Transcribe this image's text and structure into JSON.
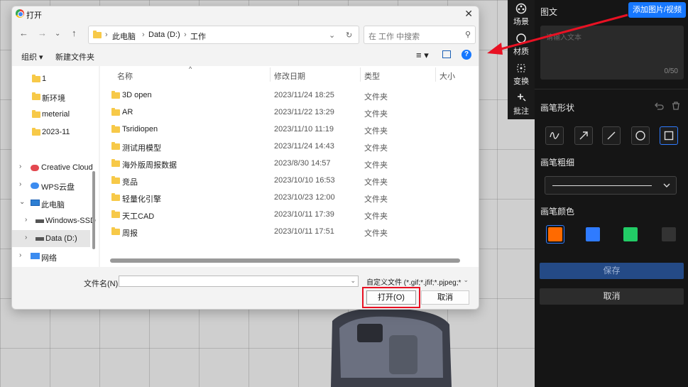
{
  "dialog": {
    "title": "打开",
    "breadcrumb": [
      "此电脑",
      "Data (D:)",
      "工作"
    ],
    "search_placeholder": "在 工作 中搜索",
    "toolbar": {
      "organize": "组织",
      "new_folder": "新建文件夹"
    },
    "nav_items": [
      {
        "label": "1",
        "icon": "folder-icon"
      },
      {
        "label": "新环境",
        "icon": "folder-icon"
      },
      {
        "label": "meterial",
        "icon": "folder-icon"
      },
      {
        "label": "2023-11",
        "icon": "folder-icon"
      },
      {
        "label": "Creative Cloud",
        "icon": "creative-cloud-icon"
      },
      {
        "label": "WPS云盘",
        "icon": "cloud-icon"
      },
      {
        "label": "此电脑",
        "icon": "pc-icon"
      },
      {
        "label": "Windows-SSD",
        "icon": "drive-icon"
      },
      {
        "label": "Data (D:)",
        "icon": "drive-icon"
      },
      {
        "label": "网络",
        "icon": "network-icon"
      }
    ],
    "columns": {
      "name": "名称",
      "date": "修改日期",
      "type": "类型",
      "size": "大小"
    },
    "files": [
      {
        "name": "3D open",
        "date": "2023/11/24 18:25",
        "type": "文件夹"
      },
      {
        "name": "AR",
        "date": "2023/11/22 13:29",
        "type": "文件夹"
      },
      {
        "name": "Tsridiopen",
        "date": "2023/11/10 11:19",
        "type": "文件夹"
      },
      {
        "name": "测试用模型",
        "date": "2023/11/24 14:43",
        "type": "文件夹"
      },
      {
        "name": "海外版周报数据",
        "date": "2023/8/30 14:57",
        "type": "文件夹"
      },
      {
        "name": "竞品",
        "date": "2023/10/10 16:53",
        "type": "文件夹"
      },
      {
        "name": "轻量化引擎",
        "date": "2023/10/23 12:00",
        "type": "文件夹"
      },
      {
        "name": "天工CAD",
        "date": "2023/10/11 17:39",
        "type": "文件夹"
      },
      {
        "name": "周报",
        "date": "2023/10/11 17:51",
        "type": "文件夹"
      }
    ],
    "filename_label": "文件名(N):",
    "filename_value": "",
    "filter": "自定义文件 (*.gif;*.jfif;*.pjpeg;*",
    "open_label": "打开(O)",
    "cancel_label": "取消"
  },
  "toolstrip": [
    {
      "label": "场景",
      "icon": "scene-icon"
    },
    {
      "label": "材质",
      "icon": "material-icon"
    },
    {
      "label": "变换",
      "icon": "transform-icon"
    },
    {
      "label": "批注",
      "icon": "annotate-icon"
    }
  ],
  "panel": {
    "text_section": "图文",
    "add_media": "添加图片/视频",
    "text_placeholder": "请输入文本",
    "text_count": "0/50",
    "brush_shape": "画笔形状",
    "brush_width": "画笔粗细",
    "brush_color": "画笔颜色",
    "colors": [
      "#ff6a00",
      "#2f7bff",
      "#22cc66",
      "#333333"
    ],
    "save": "保存",
    "cancel": "取消"
  },
  "colors": {
    "accent": "#1677ff",
    "annotation": "#e81123"
  }
}
